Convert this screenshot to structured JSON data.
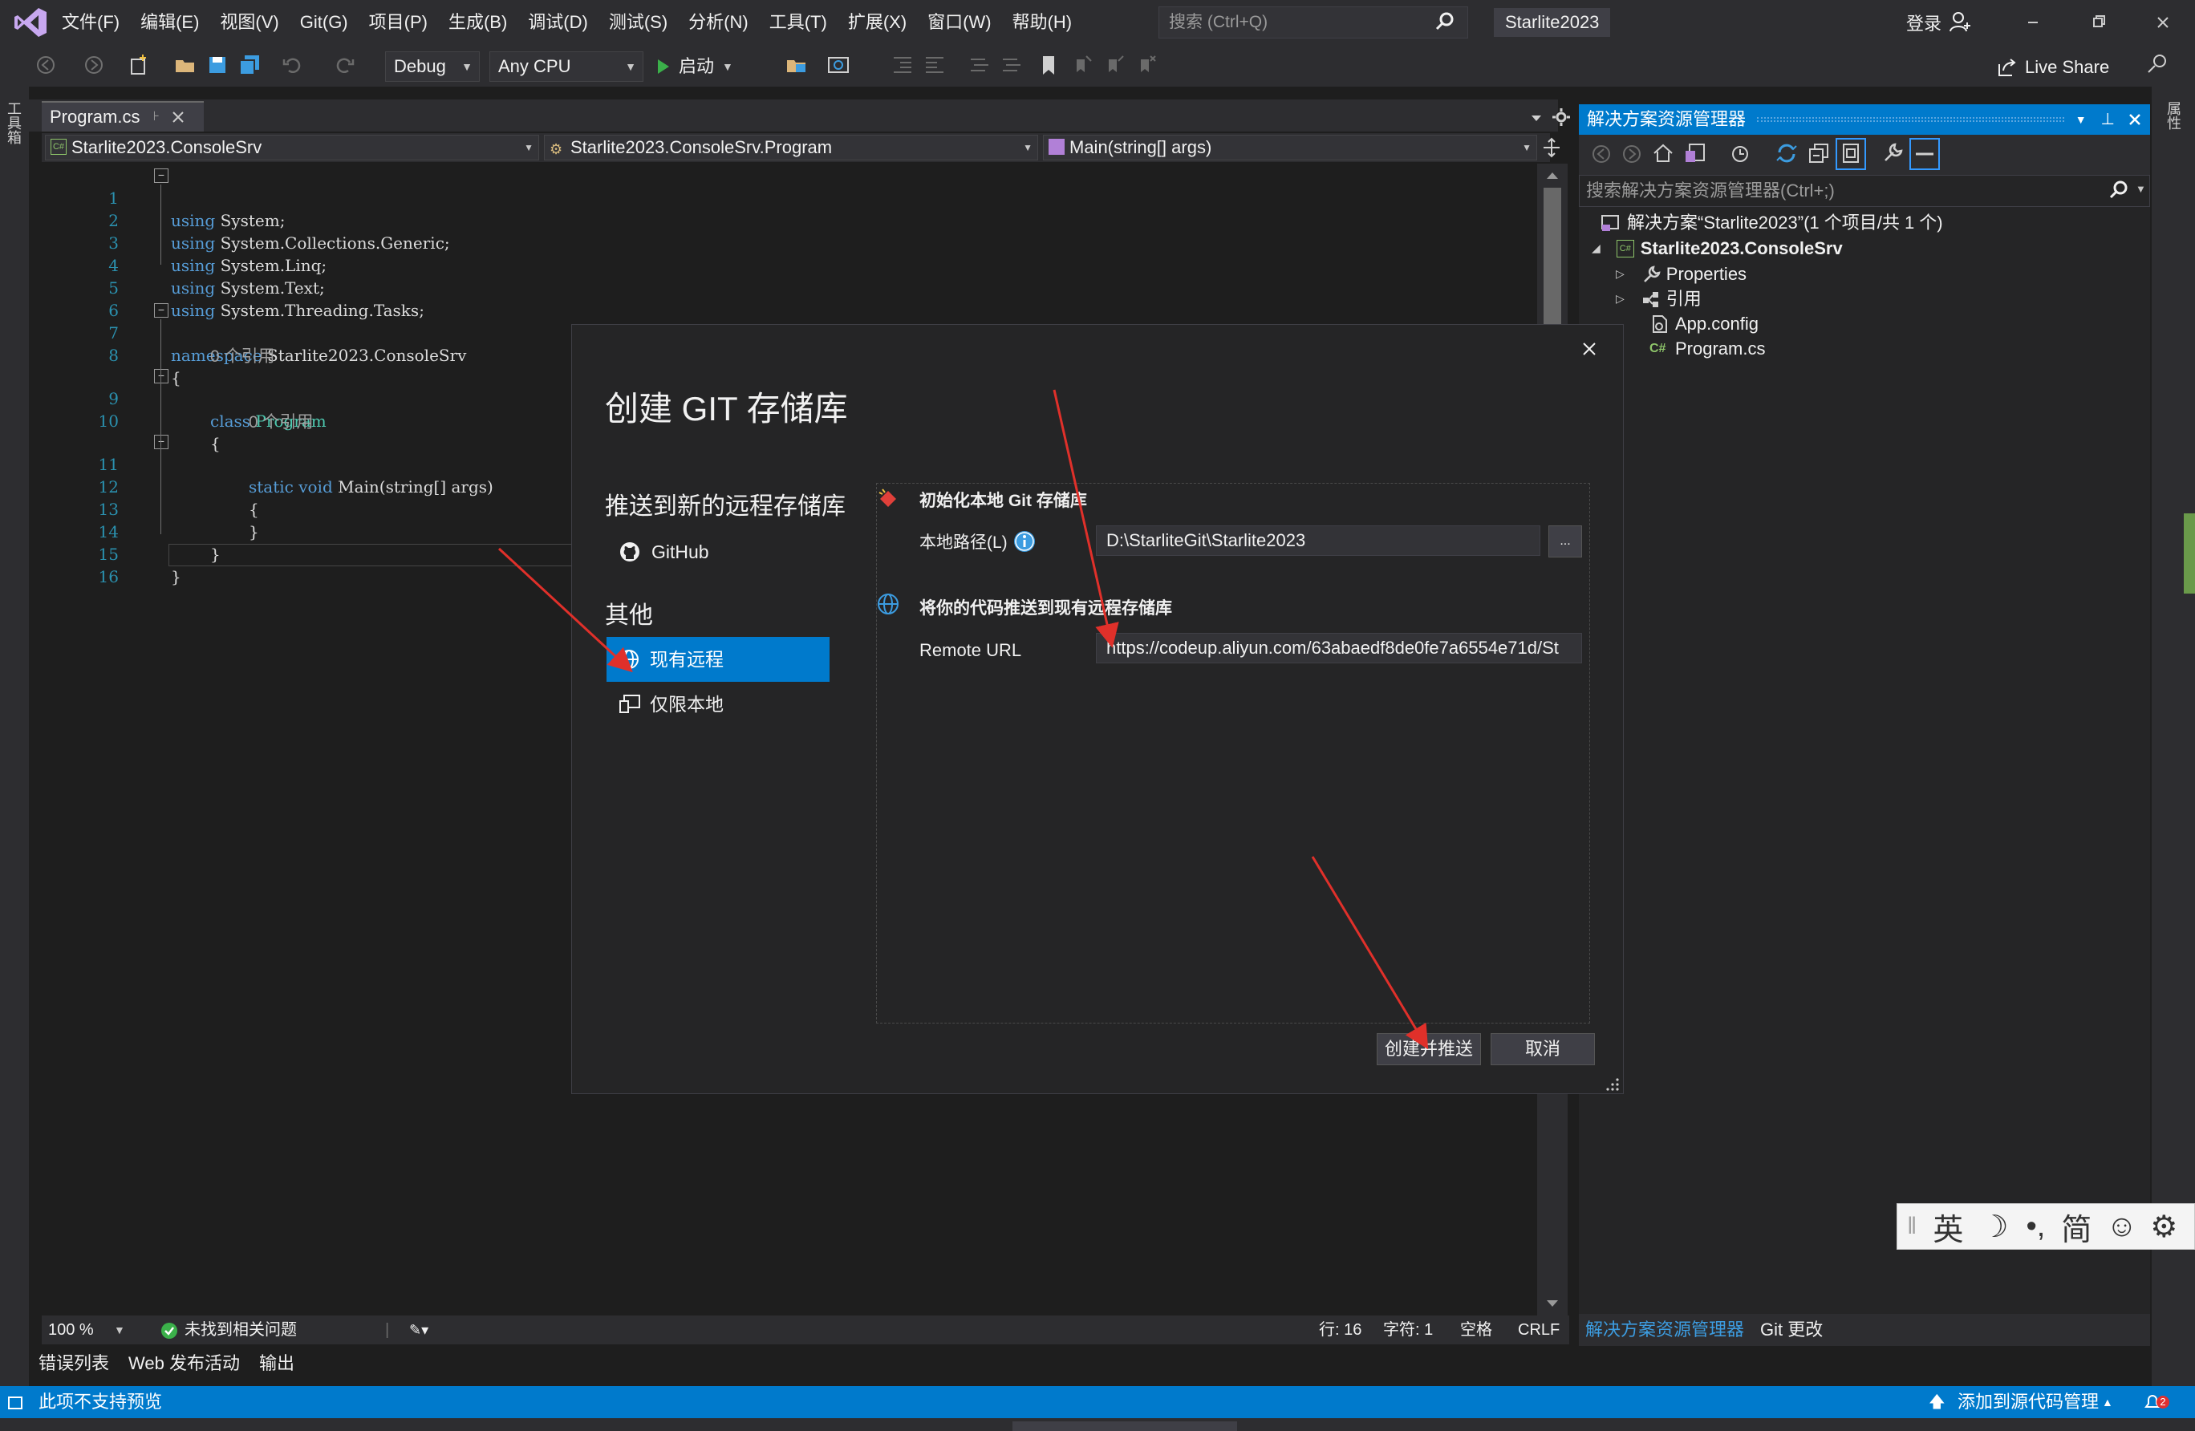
{
  "menubar": {
    "items": [
      "文件(F)",
      "编辑(E)",
      "视图(V)",
      "Git(G)",
      "项目(P)",
      "生成(B)",
      "调试(D)",
      "测试(S)",
      "分析(N)",
      "工具(T)",
      "扩展(X)",
      "窗口(W)",
      "帮助(H)"
    ],
    "search_placeholder": "搜索 (Ctrl+Q)",
    "solution_name": "Starlite2023",
    "login": "登录"
  },
  "toolbar": {
    "config": "Debug",
    "platform": "Any CPU",
    "start": "启动",
    "live_share": "Live Share"
  },
  "left_strip": {
    "label": "工具箱"
  },
  "editor": {
    "tab": "Program.cs",
    "nav_project": "Starlite2023.ConsoleSrv",
    "nav_class": "Starlite2023.ConsoleSrv.Program",
    "nav_member": "Main(string[] args)",
    "lines": [
      {
        "num": "1",
        "kw": "using",
        "text": " System;"
      },
      {
        "num": "2",
        "kw": "using",
        "text": " System.Collections.Generic;"
      },
      {
        "num": "3",
        "kw": "using",
        "text": " System.Linq;"
      },
      {
        "num": "4",
        "kw": "using",
        "text": " System.Text;"
      },
      {
        "num": "5",
        "kw": "using",
        "text": " System.Threading.Tasks;"
      },
      {
        "num": "6",
        "kw": "",
        "text": ""
      },
      {
        "num": "7",
        "kw": "namespace",
        "text": " Starlite2023.ConsoleSrv"
      },
      {
        "num": "8",
        "kw": "",
        "text": "{"
      },
      {
        "num": "9",
        "kw": "class",
        "text": " Program"
      },
      {
        "num": "10",
        "kw": "",
        "text": "{"
      },
      {
        "num": "11",
        "kw": "static void",
        "text": " Main(string[] args)"
      },
      {
        "num": "12",
        "kw": "",
        "text": "{"
      },
      {
        "num": "13",
        "kw": "",
        "text": "}"
      },
      {
        "num": "14",
        "kw": "",
        "text": "}"
      },
      {
        "num": "15",
        "kw": "",
        "text": "}"
      },
      {
        "num": "16",
        "kw": "",
        "text": ""
      }
    ],
    "ref_hint": "0 个引用",
    "zoom": "100 %",
    "issues": "未找到相关问题",
    "line_pos": "行: 16",
    "char_pos": "字符: 1",
    "spaces": "空格",
    "eol": "CRLF"
  },
  "bottom_tabs": [
    "错误列表",
    "Web 发布活动",
    "输出"
  ],
  "solution_explorer": {
    "title": "解决方案资源管理器",
    "search_placeholder": "搜索解决方案资源管理器(Ctrl+;)",
    "solution": "解决方案“Starlite2023”(1 个项目/共 1 个)",
    "project": "Starlite2023.ConsoleSrv",
    "items": [
      "Properties",
      "引用",
      "App.config",
      "Program.cs"
    ],
    "tabs": [
      "解决方案资源管理器",
      "Git 更改"
    ]
  },
  "dialog": {
    "title": "创建 GIT 存储库",
    "push_heading": "推送到新的远程存储库",
    "github": "GitHub",
    "other_heading": "其他",
    "existing_remote": "现有远程",
    "local_only": "仅限本地",
    "init_heading": "初始化本地 Git 存储库",
    "local_path_label": "本地路径(L)",
    "local_path_value": "D:\\StarliteGit\\Starlite2023",
    "browse": "...",
    "push_existing_heading": "将你的代码推送到现有远程存储库",
    "remote_url_label": "Remote URL",
    "remote_url_value": "https://codeup.aliyun.com/63abaedf8de0fe7a6554e71d/St",
    "create_push": "创建并推送",
    "cancel": "取消"
  },
  "ime": {
    "items": [
      "英",
      "简"
    ]
  },
  "statusbar": {
    "left": "此项不支持预览",
    "right": "添加到源代码管理",
    "notifications": "2"
  },
  "colors": {
    "accent": "#007acc",
    "bg": "#1e1e1e",
    "chrome": "#2d2d30",
    "arrow": "#e0302a"
  }
}
